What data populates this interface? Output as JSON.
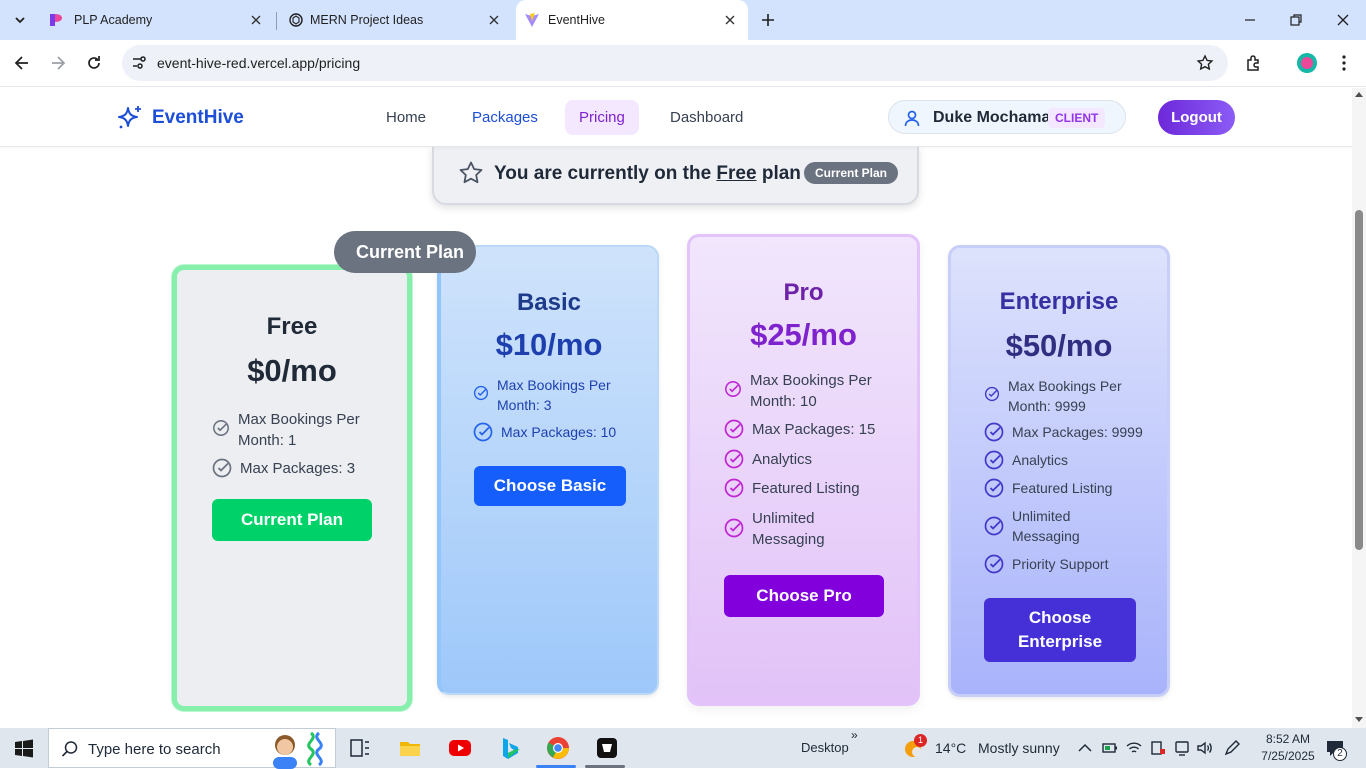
{
  "browser": {
    "tabs": [
      {
        "title": "PLP Academy",
        "active": false
      },
      {
        "title": "MERN Project Ideas",
        "active": false
      },
      {
        "title": "EventHive",
        "active": true
      }
    ],
    "url": "event-hive-red.vercel.app/pricing"
  },
  "navbar": {
    "brand": "EventHive",
    "links": [
      "Home",
      "Packages",
      "Pricing",
      "Dashboard"
    ],
    "active_link": "Pricing",
    "user_name": "Duke Mochama",
    "user_role": "CLIENT",
    "logout": "Logout"
  },
  "banner": {
    "prefix": "You are currently on the ",
    "plan": "Free",
    "suffix": " plan",
    "badge": "Current Plan"
  },
  "current_ribbon": "Current Plan",
  "plans": [
    {
      "name": "Free",
      "price": "$0/mo",
      "features": [
        "Max Bookings Per Month: 1",
        "Max Packages: 3"
      ],
      "cta": "Current Plan",
      "cta_color": "#00d26a",
      "current": true
    },
    {
      "name": "Basic",
      "price": "$10/mo",
      "features": [
        "Max Bookings Per Month: 3",
        "Max Packages: 10"
      ],
      "cta": "Choose Basic",
      "cta_color": "#155efc"
    },
    {
      "name": "Pro",
      "price": "$25/mo",
      "features": [
        "Max Bookings Per Month: 10",
        "Max Packages: 15",
        "Analytics",
        "Featured Listing",
        "Unlimited Messaging"
      ],
      "cta": "Choose Pro",
      "cta_color": "#8200db"
    },
    {
      "name": "Enterprise",
      "price": "$50/mo",
      "features": [
        "Max Bookings Per Month: 9999",
        "Max Packages: 9999",
        "Analytics",
        "Featured Listing",
        "Unlimited Messaging",
        "Priority Support"
      ],
      "cta": "Choose Enterprise",
      "cta_color": "#4530d8"
    }
  ],
  "taskbar": {
    "search_placeholder": "Type here to search",
    "desktop_label": "Desktop",
    "weather_temp": "14°C",
    "weather_desc": "Mostly sunny",
    "weather_badge": "1",
    "time": "8:52 AM",
    "date": "7/25/2025",
    "notifications": "2"
  }
}
